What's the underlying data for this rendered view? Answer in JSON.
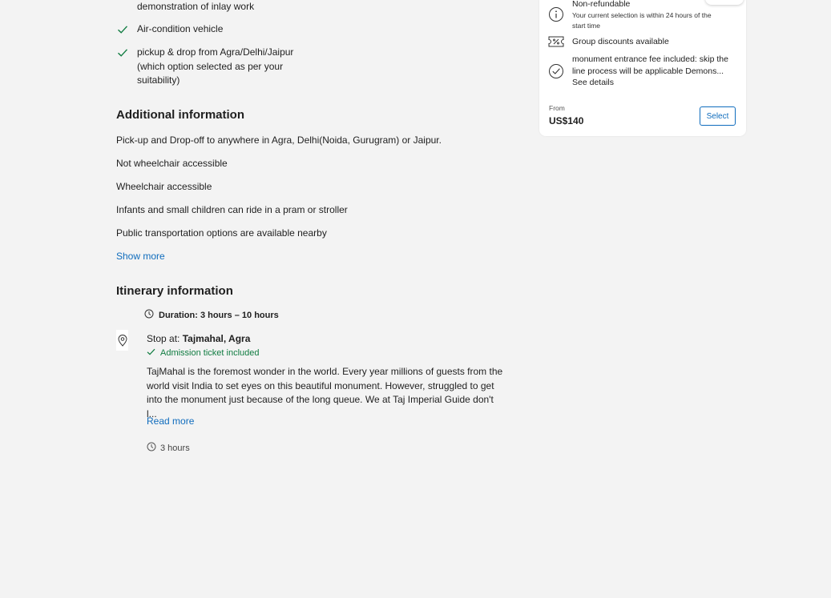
{
  "inclusions": [
    {
      "lines": [
        "demonstration of inlay work"
      ],
      "has_check": false
    },
    {
      "lines": [
        "Air-condition vehicle"
      ],
      "has_check": true
    },
    {
      "lines": [
        "pickup & drop from Agra/Delhi/Jaipur",
        "(which option selected as per your",
        "suitability)"
      ],
      "has_check": true
    }
  ],
  "additional": {
    "title": "Additional information",
    "items": [
      "Pick-up and Drop-off to anywhere in Agra, Delhi(Noida, Gurugram) or Jaipur.",
      "Not wheelchair accessible",
      "Wheelchair accessible",
      "Infants and small children can ride in a pram or stroller",
      "Public transportation options are available nearby"
    ],
    "show_more": "Show more"
  },
  "itinerary": {
    "title": "Itinerary information",
    "duration": "Duration: 3 hours – 10 hours",
    "stop_prefix": "Stop at: ",
    "stop_name": "Tajmahal, Agra",
    "admission": "Admission ticket included",
    "description": "TajMahal is the foremost wonder in the world. Every year millions of guests from the world visit India to set eyes on this beautiful monument. However, struggled to get into the monument just because of the long queue. We at Taj Imperial Guide don't l...",
    "read_more": "Read more",
    "stop_duration": "3 hours"
  },
  "card": {
    "refund_title": "Non-refundable",
    "refund_sub": "Your current selection is within 24 hours of the start time",
    "group_discount": "Group discounts available",
    "fee_text": "monument entrance fee included: skip the line process will be applicable Demons...",
    "see_details": "See details",
    "from_label": "From",
    "price": "US$140",
    "select_label": "Select"
  },
  "colors": {
    "accent": "#0f6cbd",
    "success": "#107c41",
    "background": "#f3f3f3"
  },
  "icons": {
    "check": "check-icon",
    "clock": "clock-icon",
    "pin": "location-pin-icon",
    "info": "info-icon",
    "ticket": "ticket-discount-icon",
    "check_circle": "check-circle-icon"
  }
}
